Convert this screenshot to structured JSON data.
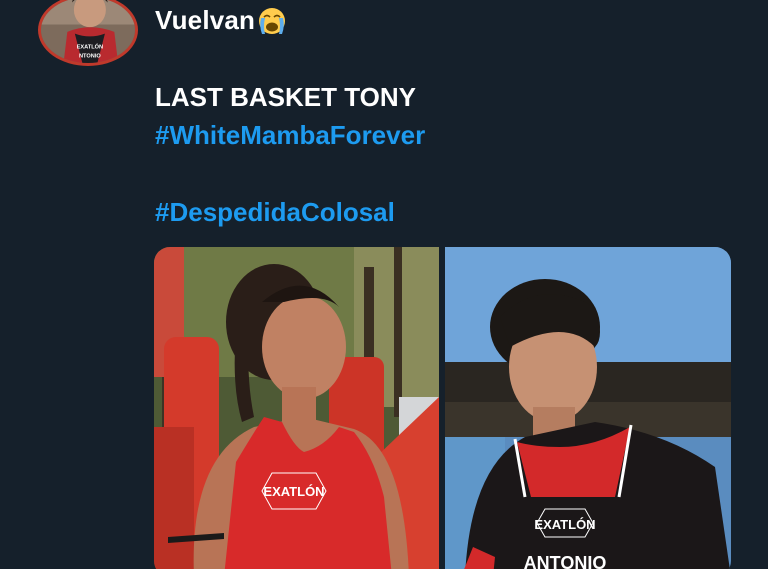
{
  "tweet": {
    "username": "Vuelvan",
    "username_emoji": "loudly-crying-face",
    "lines": [
      "LAST BASKET TONY",
      "#WhiteMambaForever",
      "#DespedidaColosal"
    ]
  },
  "media": {
    "left_shirt_text": "EXATLÓN",
    "right_shirt_text": "EXATLÓN",
    "right_name_text": "ANTONIO"
  },
  "colors": {
    "background": "#15202b",
    "hashtag": "#1d9bf0",
    "avatar_ring": "#c0392b"
  }
}
